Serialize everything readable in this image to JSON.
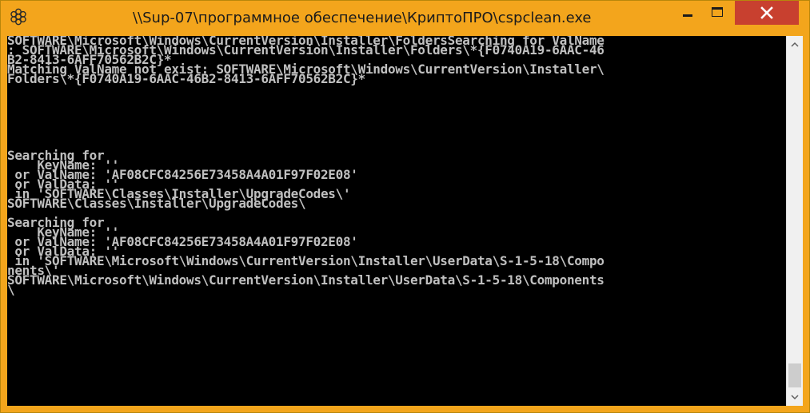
{
  "window": {
    "title": "\\\\Sup-07\\программное обеспечение\\КриптоПРО\\cspclean.exe",
    "icon": "cmd-app-icon"
  },
  "controls": {
    "minimize_icon": "minimize-icon",
    "maximize_icon": "maximize-icon",
    "close_icon": "close-icon"
  },
  "console": {
    "lines": [
      "SOFTWARE\\Microsoft\\Windows\\CurrentVersion\\Installer\\FoldersSearching for ValName",
      ": SOFTWARE\\Microsoft\\Windows\\CurrentVersion\\Installer\\Folders\\*{F0740A19-6AAC-46",
      "B2-8413-6AFF70562B2C}*",
      "Matching ValName not exist: SOFTWARE\\Microsoft\\Windows\\CurrentVersion\\Installer\\",
      "Folders\\*{F0740A19-6AAC-46B2-8413-6AFF70562B2C}*",
      "",
      "",
      "",
      "",
      "",
      "",
      "",
      "Searching for",
      "    KeyName: ''",
      " or ValName: 'AF08CFC84256E73458A4A01F97F02E08'",
      " or ValData: ''",
      " in 'SOFTWARE\\Classes\\Installer\\UpgradeCodes\\'",
      "SOFTWARE\\Classes\\Installer\\UpgradeCodes\\",
      "",
      "Searching for",
      "    KeyName: ''",
      " or ValName: 'AF08CFC84256E73458A4A01F97F02E08'",
      " or ValData: ''",
      " in 'SOFTWARE\\Microsoft\\Windows\\CurrentVersion\\Installer\\UserData\\S-1-5-18\\Compo",
      "nents\\'",
      "SOFTWARE\\Microsoft\\Windows\\CurrentVersion\\Installer\\UserData\\S-1-5-18\\Components",
      "\\"
    ]
  },
  "colors": {
    "titlebar": "#f3a51c",
    "close_button": "#c8402f",
    "console_bg": "#000000",
    "console_text": "#c0c0c0"
  }
}
